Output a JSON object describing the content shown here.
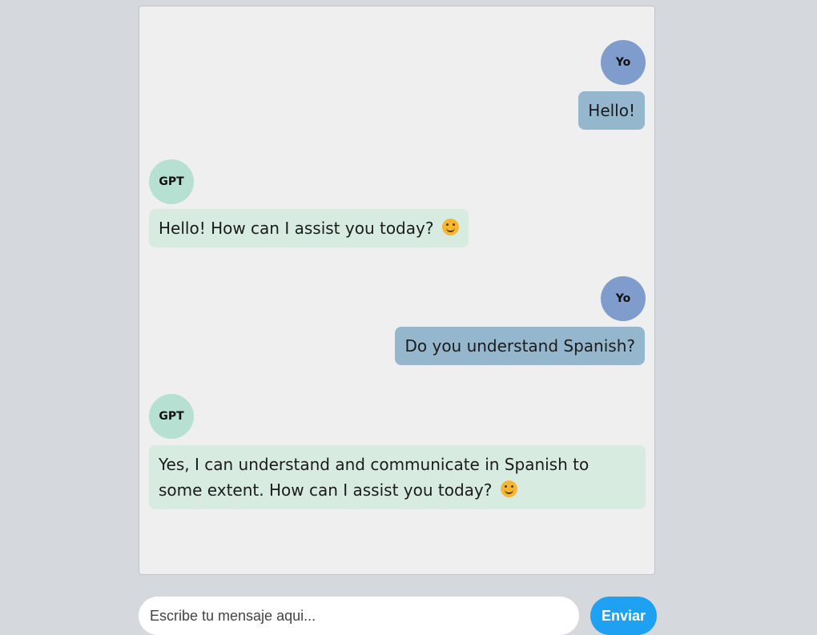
{
  "conversation": [
    {
      "role": "user",
      "avatar_label": "Yo",
      "text": "Hello!",
      "emoji": false
    },
    {
      "role": "bot",
      "avatar_label": "GPT",
      "text": "Hello! How can I assist you today?",
      "emoji": true
    },
    {
      "role": "user",
      "avatar_label": "Yo",
      "text": "Do you understand Spanish?",
      "emoji": false
    },
    {
      "role": "bot",
      "avatar_label": "GPT",
      "text": "Yes, I can understand and communicate in Spanish to some extent. How can I assist you today?",
      "emoji": true
    }
  ],
  "composer": {
    "placeholder": "Escribe tu mensaje aqui...",
    "send_label": "Enviar"
  },
  "icons": {
    "smile": "smiling-face-emoji"
  },
  "colors": {
    "page_bg": "#d5d8dc",
    "chat_bg": "#efefef",
    "user_avatar": "#7f9ccc",
    "user_bubble": "#94b7ce",
    "bot_avatar": "#b5e0d2",
    "bot_bubble": "#d7ebe0",
    "send_button": "#1ea1f2"
  }
}
